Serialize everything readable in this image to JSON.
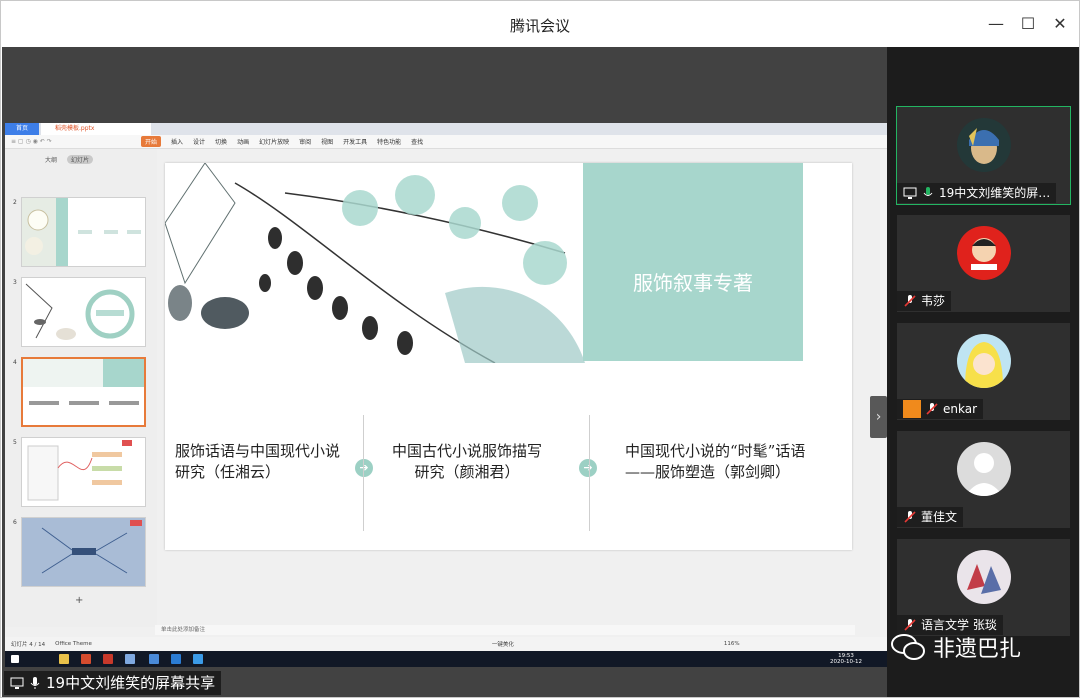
{
  "app": {
    "title": "腾讯会议"
  },
  "window_controls": {
    "minimize": "—",
    "maximize": "☐",
    "close": "✕"
  },
  "share": {
    "label": "19中文刘维笑的屏幕共享"
  },
  "ppt": {
    "tab_home": "首页",
    "tab_file": "稻壳模板.pptx",
    "menu": [
      "开始",
      "插入",
      "设计",
      "切换",
      "动画",
      "幻灯片放映",
      "审阅",
      "视图",
      "开发工具",
      "特色功能",
      "查找"
    ],
    "panel_tabs": [
      "大纲",
      "幻灯片"
    ],
    "thumb_numbers": [
      "2",
      "3",
      "4",
      "5",
      "6"
    ],
    "slide_title": "服饰叙事专著",
    "columns": [
      "服饰话语与中国现代小说研究（任湘云）",
      "中国古代小说服饰描写研究（颜湘君）",
      "中国现代小说的“时髦”话语——服饰塑造（郭剑卿）"
    ],
    "note_placeholder": "单击此处添加备注",
    "status": {
      "slide_index": "幻灯片 4 / 14",
      "theme": "Office Theme",
      "smart": "一键美化",
      "zoom": "116%"
    },
    "clock": {
      "time": "19:53",
      "date": "2020-10-12"
    }
  },
  "participants": [
    {
      "name": "19中文刘维笑的屏…",
      "speaking": true
    },
    {
      "name": "韦莎",
      "muted": true
    },
    {
      "name": "enkar",
      "muted": true
    },
    {
      "name": "董佳文",
      "muted": true
    },
    {
      "name": "语言文学 张琰",
      "muted": true
    }
  ],
  "watermark": {
    "text": "非遗巴扎"
  },
  "colors": {
    "accent_green": "#23b562",
    "teal": "#a7d6cc",
    "ppt_orange": "#e77a3a"
  }
}
